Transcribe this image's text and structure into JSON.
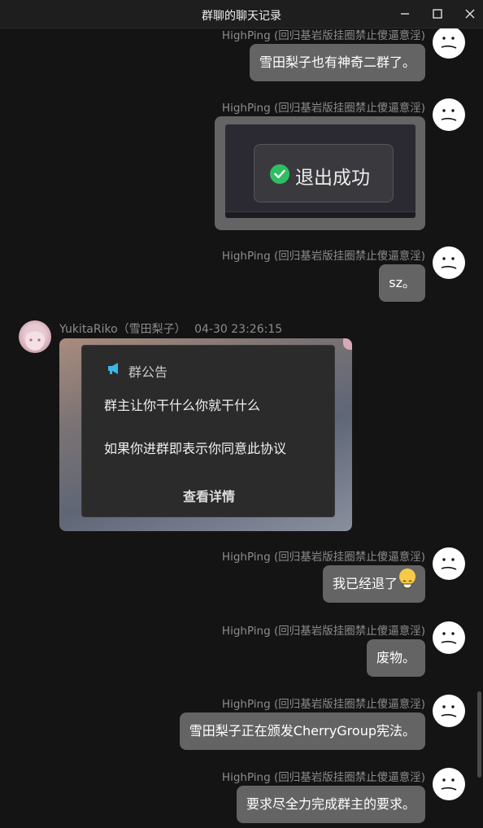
{
  "window": {
    "title": "群聊的聊天记录"
  },
  "messages": [
    {
      "sender": "HighPing (回归基岩版挂圈禁止傻逼意淫)",
      "text": "雪田梨子也有神奇二群了。"
    },
    {
      "sender": "HighPing (回归基岩版挂圈禁止傻逼意淫)",
      "image_text": "退出成功"
    },
    {
      "sender": "HighPing (回归基岩版挂圈禁止傻逼意淫)",
      "text": "sz。"
    },
    {
      "sender": "YukitaRiko（雪田梨子）",
      "time": "04-30 23:26:15",
      "announcement": {
        "title": "群公告",
        "line1": "群主让你干什么你就干什么",
        "line2": "如果你进群即表示你同意此协议",
        "detail": "查看详情"
      }
    },
    {
      "sender": "HighPing (回归基岩版挂圈禁止傻逼意淫)",
      "text": "我已经退了",
      "emoji": "grinning-face"
    },
    {
      "sender": "HighPing (回归基岩版挂圈禁止傻逼意淫)",
      "text": "废物。"
    },
    {
      "sender": "HighPing (回归基岩版挂圈禁止傻逼意淫)",
      "text": "雪田梨子正在颁发CherryGroup宪法。"
    },
    {
      "sender": "HighPing (回归基岩版挂圈禁止傻逼意淫)",
      "text": "要求尽全力完成群主的要求。"
    }
  ],
  "colors": {
    "background": "#141414",
    "bubble": "#646464",
    "name": "#8c8c8c",
    "success": "#2fbf62"
  }
}
